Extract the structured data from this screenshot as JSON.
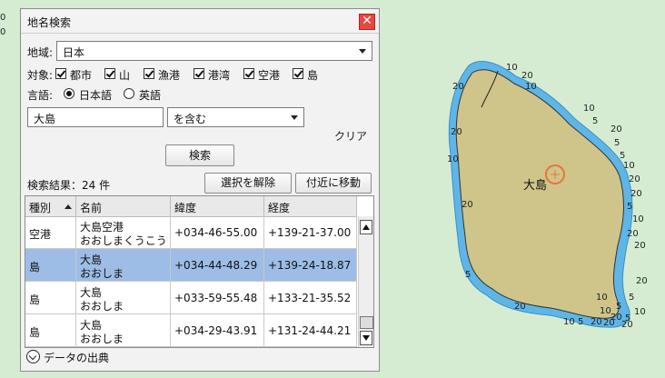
{
  "edge_numbers": [
    "0",
    "0"
  ],
  "dialog": {
    "title": "地名検索",
    "region_label": "地域:",
    "region_value": "日本",
    "target_label": "対象:",
    "targets": [
      {
        "label": "都市",
        "checked": true
      },
      {
        "label": "山",
        "checked": true
      },
      {
        "label": "漁港",
        "checked": true
      },
      {
        "label": "港湾",
        "checked": true
      },
      {
        "label": "空港",
        "checked": true
      },
      {
        "label": "島",
        "checked": true
      }
    ],
    "language_label": "言語:",
    "languages": [
      {
        "label": "日本語",
        "selected": true
      },
      {
        "label": "英語",
        "selected": false
      }
    ],
    "search_text": "大島",
    "match_mode": "を含む",
    "clear_label": "クリア",
    "search_button": "検索",
    "result_count": "検索結果：24 件",
    "deselect_button": "選択を解除",
    "goto_button": "付近に移動",
    "columns": [
      "種別",
      "名前",
      "緯度",
      "経度"
    ],
    "rows": [
      {
        "type": "空港",
        "name": "大島空港",
        "kana": "おおしまくうこう",
        "lat": "+034-46-55.00",
        "lon": "+139-21-37.00",
        "selected": false
      },
      {
        "type": "島",
        "name": "大島",
        "kana": "おおしま",
        "lat": "+034-44-48.29",
        "lon": "+139-24-18.87",
        "selected": true
      },
      {
        "type": "島",
        "name": "大島",
        "kana": "おおしま",
        "lat": "+033-59-55.48",
        "lon": "+133-21-35.52",
        "selected": false
      },
      {
        "type": "島",
        "name": "大島",
        "kana": "おおしま",
        "lat": "+034-29-43.91",
        "lon": "+131-24-44.21",
        "selected": false
      }
    ],
    "footer_label": "データの出典"
  },
  "map": {
    "island_label": "大島",
    "depth_labels": [
      "10",
      "20",
      "10",
      "5",
      "20",
      "10",
      "5",
      "5",
      "10",
      "20",
      "10",
      "20",
      "5",
      "10",
      "20",
      "20",
      "20",
      "5",
      "10",
      "20",
      "20",
      "5",
      "5",
      "10",
      "20",
      "5",
      "20",
      "20",
      "20",
      "10",
      "20",
      "5",
      "10",
      "20"
    ],
    "colors": {
      "land": "#cfc48a",
      "shallow": "#5fb6e6",
      "sea": "#d5ecd3",
      "marker": "#e8743b"
    }
  }
}
